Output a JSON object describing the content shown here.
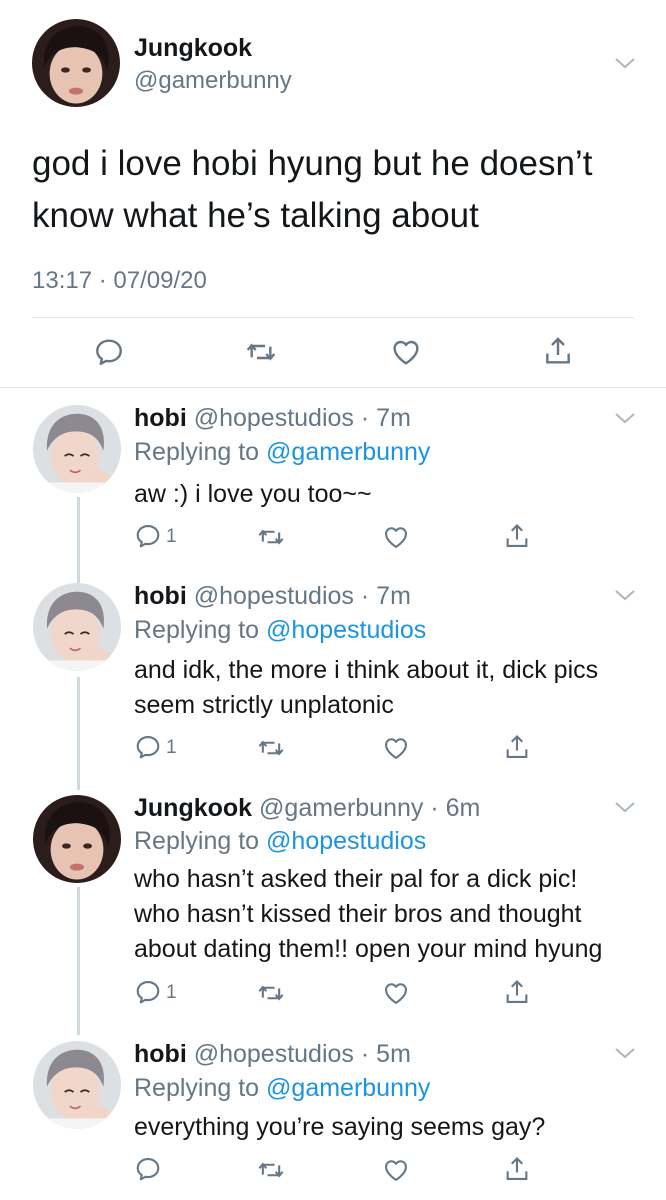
{
  "main_tweet": {
    "name": "Jungkook",
    "handle": "@gamerbunny",
    "text_lines": [
      "god i love hobi hyung but he doesn’t",
      "know what he’s talking about"
    ],
    "timestamp": "13:17 · 07/09/20",
    "actions": [
      "reply-icon",
      "retweet-icon",
      "like-icon",
      "share-icon"
    ]
  },
  "replies": [
    {
      "name": "hobi",
      "handle": "@hopestudios",
      "time": "· 7m",
      "replying_prefix": "Replying to",
      "replying_to": "@gamerbunny",
      "text_lines": [
        "aw :) i love you too~~"
      ],
      "reply_count": "1"
    },
    {
      "name": "hobi",
      "handle": "@hopestudios",
      "time": "· 7m",
      "replying_prefix": "Replying to",
      "replying_to": "@hopestudios",
      "text_lines": [
        "and idk, the more i think about it, dick pics",
        "seem strictly unplatonic"
      ],
      "reply_count": "1"
    },
    {
      "name": "Jungkook",
      "handle": "@gamerbunny",
      "time": "· 6m",
      "replying_prefix": "Replying to",
      "replying_to": "@hopestudios",
      "text_lines": [
        "who hasn’t asked their pal for a dick pic!",
        "who hasn’t kissed their bros and thought",
        "about dating them!! open your mind hyung"
      ],
      "reply_count": "1"
    },
    {
      "name": "hobi",
      "handle": "@hopestudios",
      "time": "· 5m",
      "replying_prefix": "Replying to",
      "replying_to": "@gamerbunny",
      "text_lines": [
        "everything you’re saying seems gay?"
      ],
      "reply_count": ""
    }
  ],
  "colors": {
    "link": "#1b95e0",
    "muted": "#657786",
    "text": "#14171a",
    "divider": "#e1e8ed"
  }
}
